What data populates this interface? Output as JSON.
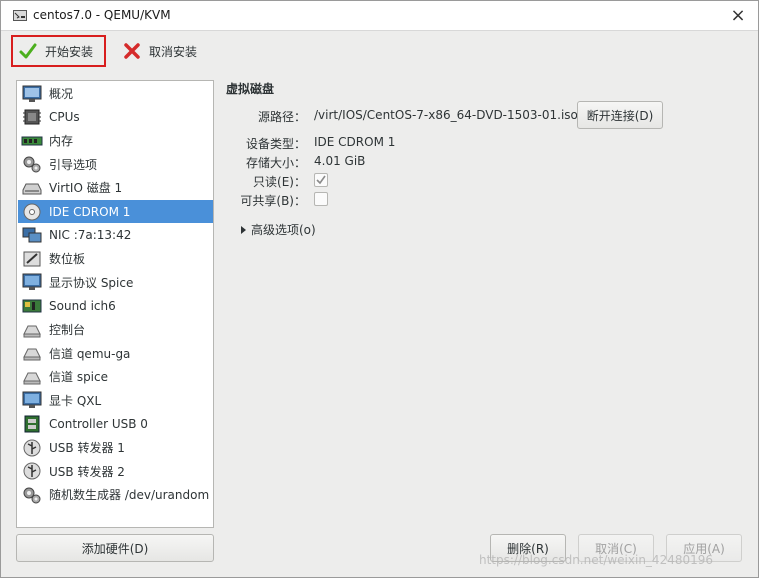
{
  "window": {
    "title": "centos7.0 - QEMU/KVM",
    "close_glyph": "×"
  },
  "toolbar": {
    "start_label": "开始安装",
    "cancel_label": "取消安装"
  },
  "devices": [
    {
      "label": "概况",
      "icon": "monitor-icon"
    },
    {
      "label": "CPUs",
      "icon": "cpu-icon"
    },
    {
      "label": "内存",
      "icon": "memory-icon"
    },
    {
      "label": "引导选项",
      "icon": "gears-icon"
    },
    {
      "label": "VirtIO 磁盘 1",
      "icon": "hard-disk-icon"
    },
    {
      "label": "IDE CDROM 1",
      "icon": "cdrom-icon"
    },
    {
      "label": "NIC :7a:13:42",
      "icon": "network-icon"
    },
    {
      "label": "数位板",
      "icon": "tablet-icon"
    },
    {
      "label": "显示协议 Spice",
      "icon": "display-icon"
    },
    {
      "label": "Sound ich6",
      "icon": "sound-card-icon"
    },
    {
      "label": "控制台",
      "icon": "serial-icon"
    },
    {
      "label": "信道 qemu-ga",
      "icon": "serial-icon"
    },
    {
      "label": "信道 spice",
      "icon": "serial-icon"
    },
    {
      "label": "显卡 QXL",
      "icon": "display-icon"
    },
    {
      "label": "Controller USB 0",
      "icon": "controller-icon"
    },
    {
      "label": "USB 转发器 1",
      "icon": "usb-icon"
    },
    {
      "label": "USB 转发器 2",
      "icon": "usb-icon"
    },
    {
      "label": "随机数生成器 /dev/urandom",
      "icon": "gears-icon"
    }
  ],
  "selected_device": "IDE CDROM 1",
  "add_hardware_label": "添加硬件(D)",
  "detail": {
    "section_title": "虚拟磁盘",
    "source_label": "源路径：",
    "source_value": "/virt/IOS/CentOS-7-x86_64-DVD-1503-01.iso",
    "disconnect_label": "断开连接(D)",
    "device_type_label": "设备类型：",
    "device_type_value": "IDE CDROM 1",
    "storage_size_label": "存储大小：",
    "storage_size_value": "4.01 GiB",
    "readonly_label": "只读(E)：",
    "readonly_checked": true,
    "shareable_label": "可共享(B)：",
    "shareable_checked": false,
    "advanced_label": "高级选项(o)"
  },
  "buttons": {
    "remove": "删除(R)",
    "cancel": "取消(C)",
    "apply": "应用(A)"
  },
  "watermark": "https://blog.csdn.net/weixin_42480196",
  "colors": {
    "selection": "#4a90d9",
    "highlight_border": "#d81e1e",
    "start_check": "#4caf1e",
    "cancel_x": "#d52b2b"
  }
}
